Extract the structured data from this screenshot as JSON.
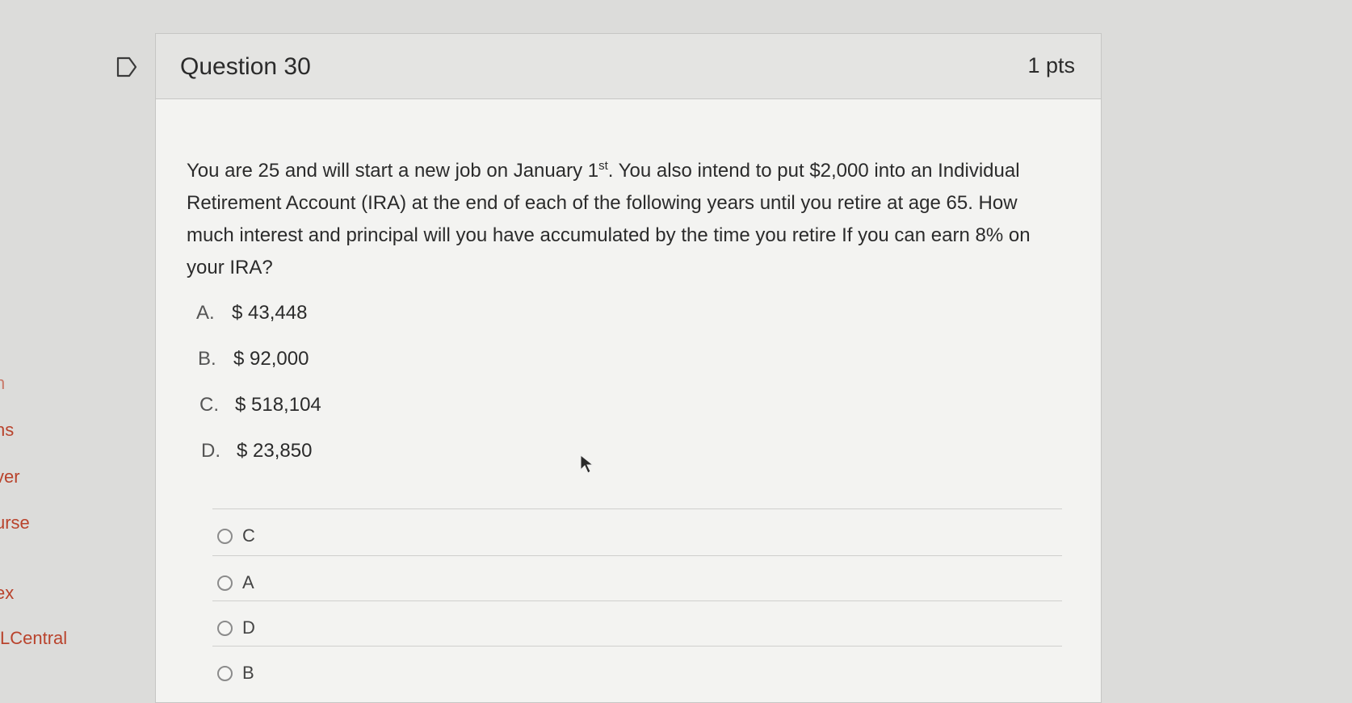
{
  "sidebar": {
    "items": [
      {
        "label": "n"
      },
      {
        "label": "ns"
      },
      {
        "label": "ver"
      },
      {
        "label": "urse"
      },
      {
        "label": "ex"
      },
      {
        "label": "LCentral"
      }
    ]
  },
  "question": {
    "title": "Question 30",
    "points": "1 pts",
    "text_before": "You are 25 and will start a new job on January 1",
    "text_sup": "st",
    "text_after": ". You also intend to put $2,000 into an Individual Retirement Account (IRA) at the end of each of the following years until you retire at age 65.  How much interest and principal will you have accumulated by the time you retire If you can earn 8% on your IRA?",
    "choices": [
      {
        "letter": "A.",
        "value": "$ 43,448"
      },
      {
        "letter": "B.",
        "value": "$ 92,000"
      },
      {
        "letter": "C.",
        "value": "$ 518,104"
      },
      {
        "letter": "D.",
        "value": "$  23,850"
      }
    ],
    "answers": [
      {
        "label": "C",
        "selected": false
      },
      {
        "label": "A",
        "selected": false
      },
      {
        "label": "D",
        "selected": false
      },
      {
        "label": "B",
        "selected": false
      }
    ]
  },
  "icons": {
    "flag": "flag-icon",
    "radio": "radio-icon",
    "cursor": "mouse-pointer-icon"
  }
}
